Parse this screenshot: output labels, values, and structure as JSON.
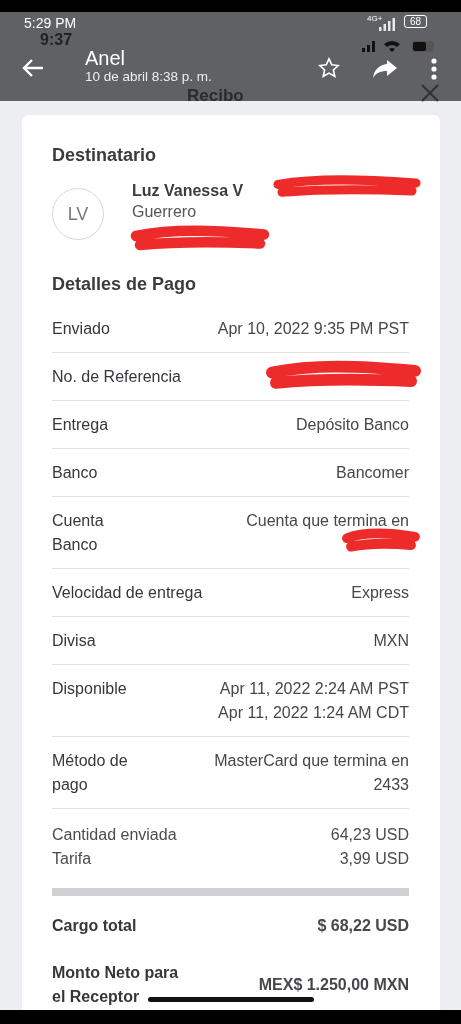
{
  "viewer": {
    "device_time": "5:29 PM",
    "network": "4G+",
    "battery": "68",
    "sender": "Anel",
    "timestamp": "10 de abril 8:38 p. m."
  },
  "receipt_bar": {
    "time": "9:37",
    "title": "Recibo"
  },
  "recipient": {
    "heading": "Destinatario",
    "initials": "LV",
    "name": "Luz Vanessa V",
    "name_redacted": true,
    "region": "Guerrero",
    "address_redacted": true
  },
  "details": {
    "heading": "Detalles de Pago",
    "rows": [
      {
        "label": [
          "Enviado"
        ],
        "value": [
          "Apr 10, 2022 9:35 PM PST"
        ],
        "redacted": false
      },
      {
        "label": [
          "No. de Referencia"
        ],
        "value": [],
        "redacted": true
      },
      {
        "label": [
          "Entrega"
        ],
        "value": [
          "Depósito Banco"
        ],
        "redacted": false
      },
      {
        "label": [
          "Banco"
        ],
        "value": [
          "Bancomer"
        ],
        "redacted": false
      },
      {
        "label": [
          "Cuenta",
          "Banco"
        ],
        "value": [
          "Cuenta que termina en"
        ],
        "redacted": true
      },
      {
        "label": [
          "Velocidad de entrega"
        ],
        "value": [
          "Express"
        ],
        "redacted": false
      },
      {
        "label": [
          "Divisa"
        ],
        "value": [
          "MXN"
        ],
        "redacted": false
      },
      {
        "label": [
          "Disponible"
        ],
        "value": [
          "Apr 11, 2022 2:24 AM PST",
          "Apr 11, 2022 1:24 AM CDT"
        ],
        "redacted": false
      },
      {
        "label": [
          "Método de",
          "pago"
        ],
        "value": [
          "MasterCard que termina en",
          "2433"
        ],
        "redacted": false
      }
    ]
  },
  "charges": [
    {
      "label": "Cantidad enviada",
      "value": "64,23 USD"
    },
    {
      "label": "Tarifa",
      "value": "3,99 USD"
    }
  ],
  "totals": [
    {
      "label": [
        "Cargo total"
      ],
      "value": "$ 68,22 USD"
    },
    {
      "label": [
        "Monto Neto para",
        "el Receptor"
      ],
      "value": "MEX$ 1.250,00 MXN"
    }
  ]
}
